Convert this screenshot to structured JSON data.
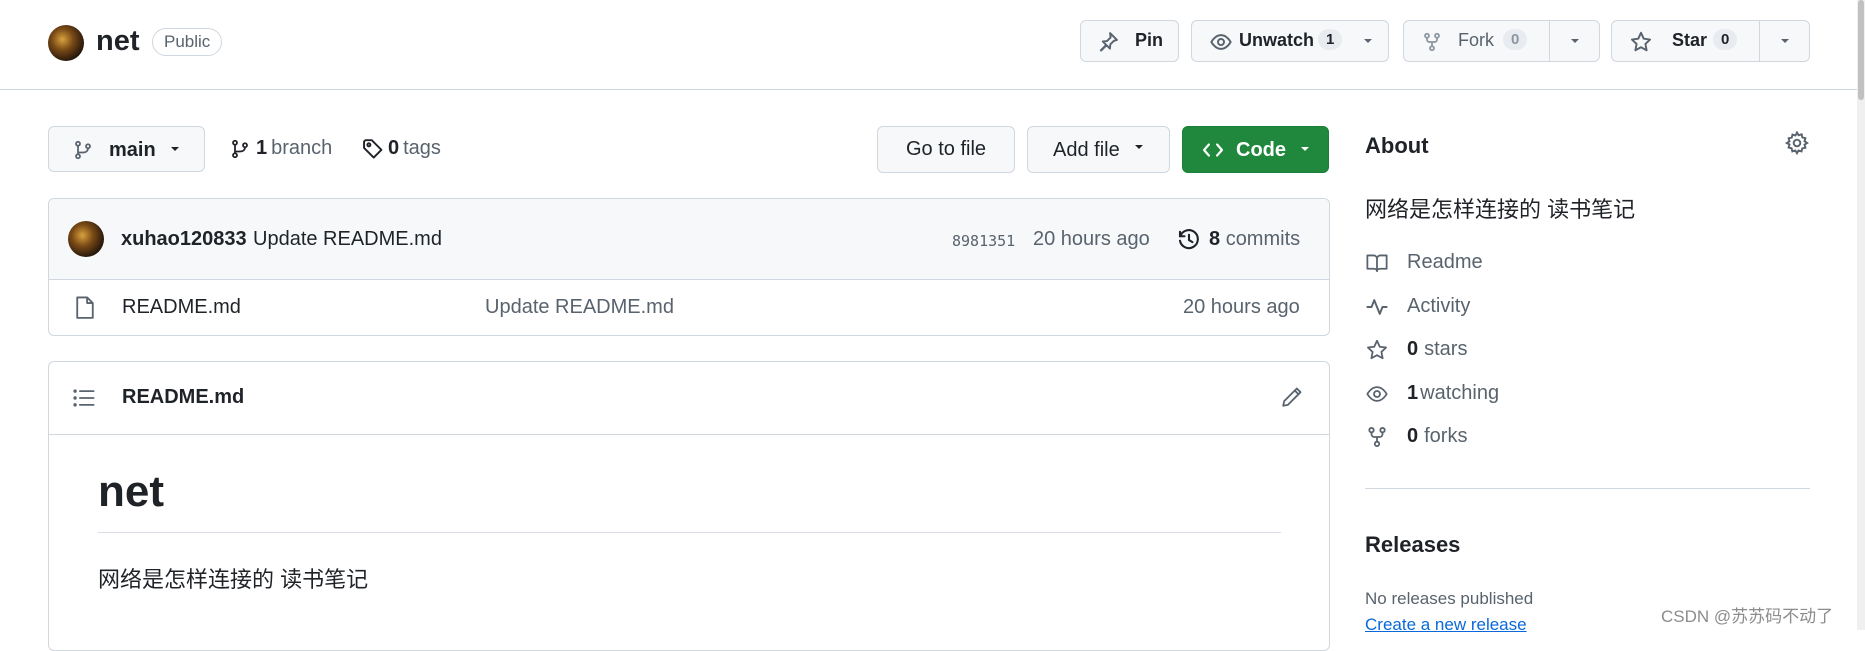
{
  "repo": {
    "name": "net",
    "visibility": "Public"
  },
  "header_actions": {
    "pin_label": "Pin",
    "unwatch_label": "Unwatch",
    "unwatch_count": "1",
    "fork_label": "Fork",
    "fork_count": "0",
    "star_label": "Star",
    "star_count": "0"
  },
  "toolbar": {
    "branch_name": "main",
    "branch_count": "1",
    "branch_label": "branch",
    "tag_count": "0",
    "tag_label": "tags",
    "go_to_file": "Go to file",
    "add_file": "Add file",
    "code": "Code"
  },
  "latest_commit": {
    "author": "xuhao120833",
    "message": "Update README.md",
    "sha": "8981351",
    "time": "20 hours ago",
    "commit_count": "8",
    "commit_label": "commits"
  },
  "files": [
    {
      "name": "README.md",
      "message": "Update README.md",
      "time": "20 hours ago"
    }
  ],
  "readme": {
    "filename": "README.md",
    "heading": "net",
    "paragraph": "网络是怎样连接的 读书笔记"
  },
  "about": {
    "title": "About",
    "description": "网络是怎样连接的 读书笔记",
    "readme_label": "Readme",
    "activity_label": "Activity",
    "stars_count": "0",
    "stars_label": "stars",
    "watching_count": "1",
    "watching_label": "watching",
    "forks_count": "0",
    "forks_label": "forks"
  },
  "releases": {
    "title": "Releases",
    "empty_text": "No releases published",
    "create_link": "Create a new release"
  },
  "watermark": "CSDN @苏苏码不动了",
  "colors": {
    "accent_green": "#1f883d",
    "link_blue": "#0969da",
    "border": "#d0d7de",
    "muted_text": "#59636e"
  }
}
